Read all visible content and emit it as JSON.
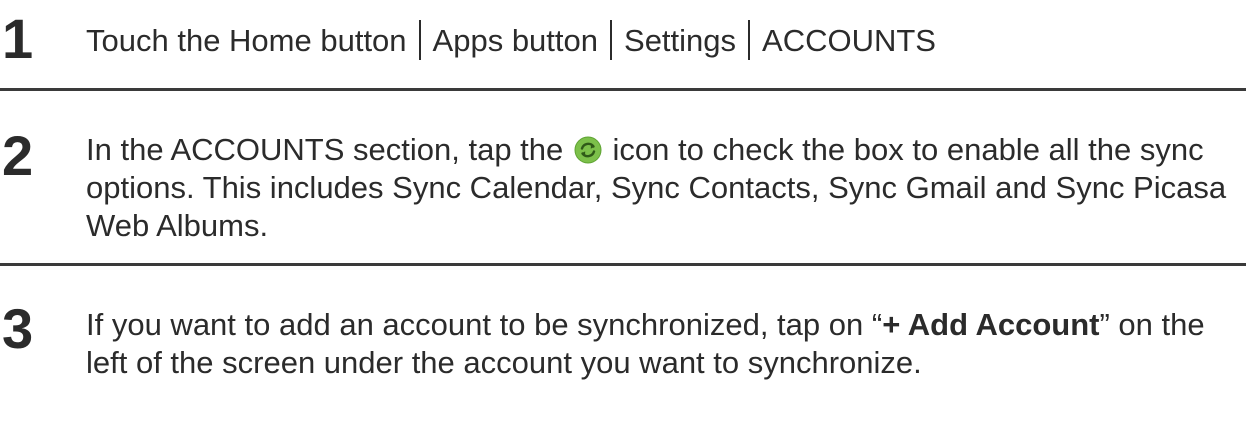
{
  "steps": [
    {
      "number": "1",
      "path": [
        "Touch the Home button",
        "Apps button",
        "Settings",
        "ACCOUNTS"
      ]
    },
    {
      "number": "2",
      "text_before_icon": "In the ACCOUNTS section, tap the",
      "icon": "sync-icon",
      "text_after_icon": "icon to check the box to enable all the sync options. This includes Sync Calendar, Sync Contacts, Sync Gmail and Sync Picasa Web Albums."
    },
    {
      "number": "3",
      "text_before_bold": "If you want to add an account to be synchronized, tap on “",
      "bold": "+ Add Account",
      "text_after_bold": "” on the left of the screen under the account you want to synchronize."
    }
  ],
  "colors": {
    "text": "#2b2b2b",
    "divider": "#3a3a3a",
    "sync_icon_fill": "#7cc04a",
    "sync_icon_arrow": "#3d6b22"
  }
}
